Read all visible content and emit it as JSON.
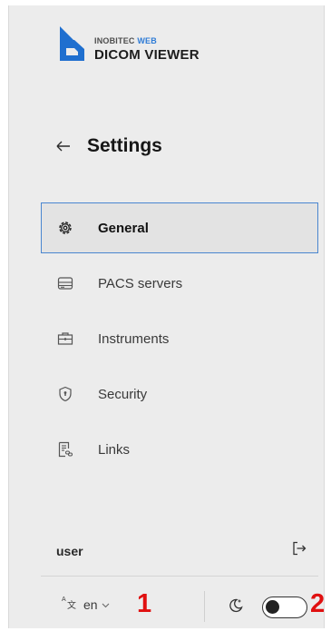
{
  "brand": {
    "company": "INOBITEC",
    "web": "WEB",
    "product": "DICOM VIEWER"
  },
  "header": {
    "back_icon": "arrow-left-icon",
    "title": "Settings"
  },
  "nav": {
    "items": [
      {
        "label": "General",
        "icon": "gear-icon",
        "active": true
      },
      {
        "label": "PACS servers",
        "icon": "server-icon",
        "active": false
      },
      {
        "label": "Instruments",
        "icon": "toolbox-icon",
        "active": false
      },
      {
        "label": "Security",
        "icon": "shield-icon",
        "active": false
      },
      {
        "label": "Links",
        "icon": "link-document-icon",
        "active": false
      }
    ]
  },
  "user": {
    "name": "user",
    "logout_icon": "logout-icon"
  },
  "footer": {
    "language": "en",
    "badge_language": "1",
    "badge_theme": "2",
    "theme_toggle_on": false
  },
  "colors": {
    "accent": "#2e7bd6",
    "active_border": "#4a86d0",
    "badge": "#e01010"
  }
}
